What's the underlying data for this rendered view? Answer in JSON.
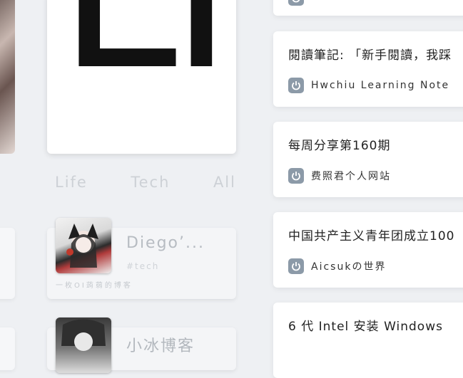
{
  "logo": {
    "text": "LF"
  },
  "tabs": [
    "Life",
    "Tech",
    "All"
  ],
  "friends": [
    {
      "name": "Diego’...",
      "tag": "#tech",
      "desc": "一枚OI蒟蒻的博客"
    },
    {
      "name": "小冰博客"
    }
  ],
  "articles": [
    {
      "title": "閱讀筆記: 「新手閱讀，我踩",
      "source": "Hwchiu Learning Note"
    },
    {
      "title": "每周分享第160期",
      "source": "费照君个人网站"
    },
    {
      "title": "中国共产主义青年团成立100",
      "source": "Aicsukの世界"
    },
    {
      "title": "6 代 Intel 安装 Windows"
    }
  ],
  "colors": {
    "icon_bg": "#8c9aa8",
    "card_bg": "#ffffff",
    "page_bg": "#eef0f3"
  },
  "icons": {
    "source": "power-icon"
  }
}
